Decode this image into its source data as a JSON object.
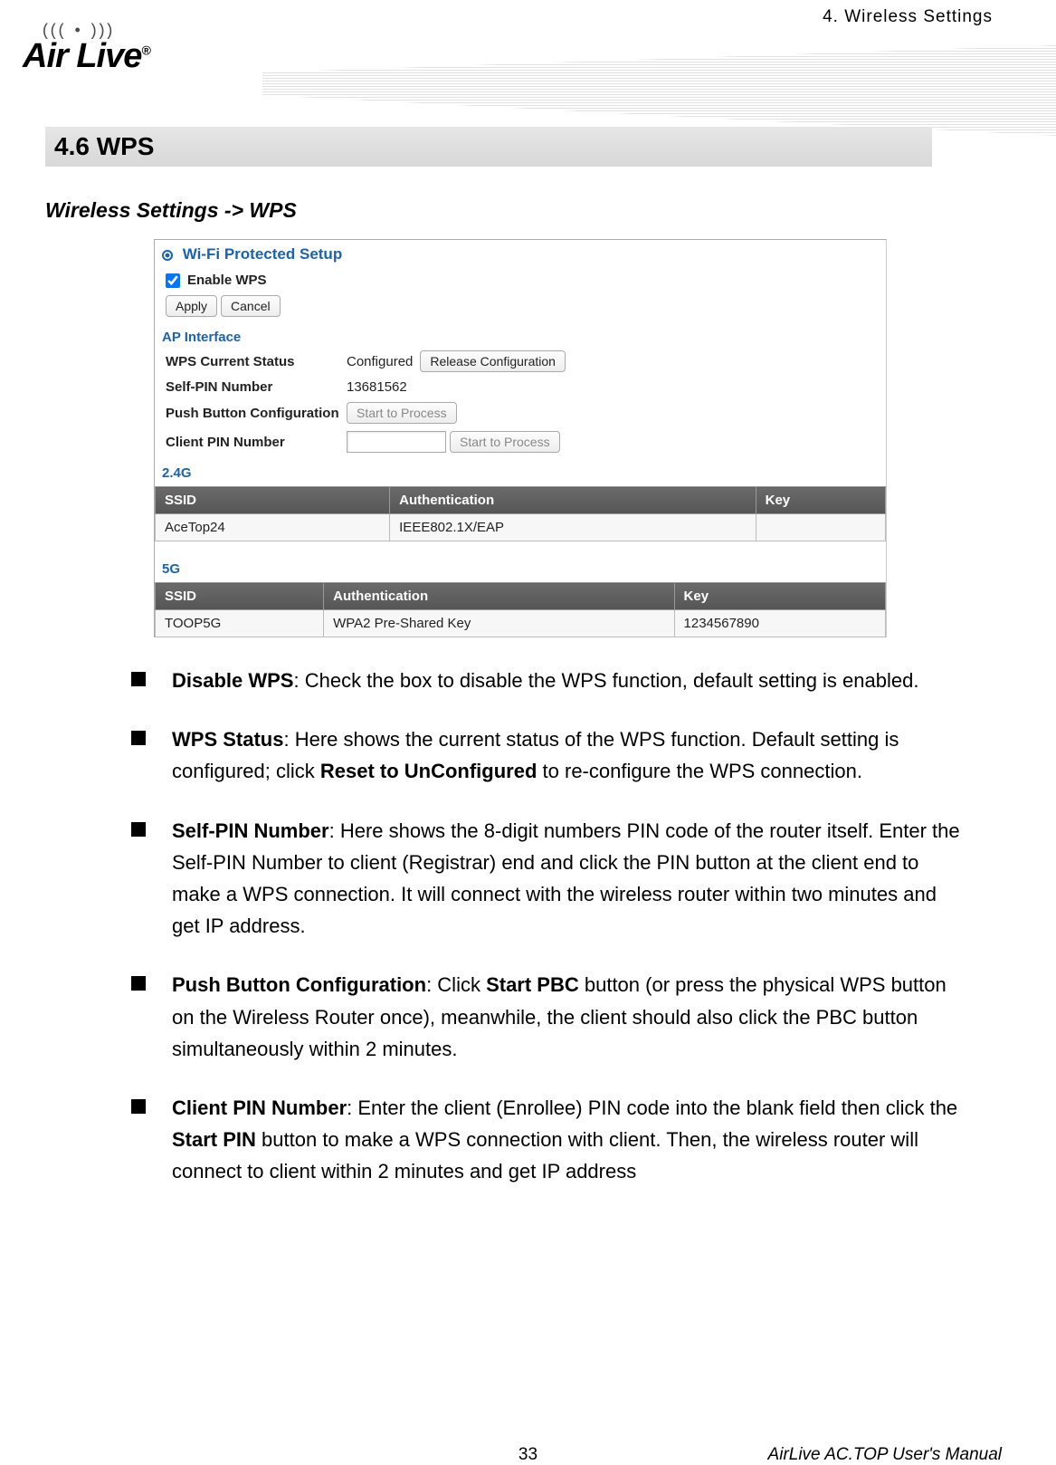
{
  "header": {
    "chapter": "4. Wireless Settings",
    "brand": "Air Live",
    "reg": "®"
  },
  "section": {
    "title": "4.6 WPS",
    "breadcrumb": "Wireless Settings -> WPS"
  },
  "screenshot": {
    "panel_title": "Wi-Fi Protected Setup",
    "enable_label": "Enable WPS",
    "apply_label": "Apply",
    "cancel_label": "Cancel",
    "ap_interface_label": "AP Interface",
    "wps_status_label": "WPS Current Status",
    "wps_status_value": "Configured",
    "release_btn": "Release Configuration",
    "self_pin_label": "Self-PIN Number",
    "self_pin_value": "13681562",
    "pbc_label": "Push Button Configuration",
    "pbc_btn": "Start to Process",
    "client_pin_label": "Client PIN Number",
    "client_pin_btn": "Start to Process",
    "band24_label": "2.4G",
    "band5_label": "5G",
    "col_ssid": "SSID",
    "col_auth": "Authentication",
    "col_key": "Key",
    "row24": {
      "ssid": "AceTop24",
      "auth": "IEEE802.1X/EAP",
      "key": ""
    },
    "row5": {
      "ssid": "TOOP5G",
      "auth": "WPA2 Pre-Shared Key",
      "key": "1234567890"
    }
  },
  "bullets": {
    "b1_t": "Disable WPS",
    "b1_d": ": Check the box to disable the WPS function, default setting is enabled.",
    "b2_t": "WPS Status",
    "b2_d1": ": Here shows the current status of the WPS function. Default setting is configured; click ",
    "b2_b": "Reset to UnConfigured",
    "b2_d2": " to re-configure the WPS connection.",
    "b3_t": "Self-PIN Number",
    "b3_d": ": Here shows the 8-digit numbers PIN code of the router itself. Enter the Self-PIN Number to client (Registrar) end and click the PIN button at the client end to make a WPS connection. It will connect with the wireless router within two minutes and get IP address.",
    "b4_t": "Push Button Configuration",
    "b4_d1": ": Click ",
    "b4_b": "Start PBC",
    "b4_d2": " button (or press the physical WPS button on the Wireless Router once), meanwhile, the client should also click the PBC button simultaneously within 2 minutes.",
    "b5_t": "Client PIN Number",
    "b5_d1": ": Enter the client (Enrollee) PIN code into the blank field then click the ",
    "b5_b": "Start PIN",
    "b5_d2": " button to make a WPS connection with client. Then, the wireless router will connect to client within 2 minutes and get IP address"
  },
  "footer": {
    "page": "33",
    "manual": "AirLive AC.TOP User's Manual"
  }
}
